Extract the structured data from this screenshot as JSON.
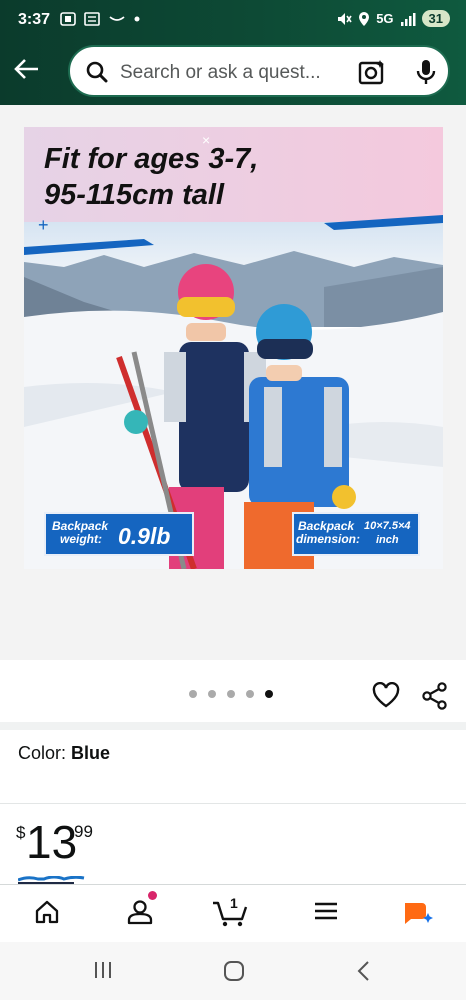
{
  "status_bar": {
    "time": "3:37",
    "network": "5G",
    "battery": "31"
  },
  "search": {
    "placeholder": "Search or ask a quest..."
  },
  "product_image": {
    "headline_line1": "Fit for ages 3-7,",
    "headline_line2": "95-115cm tall",
    "badge_weight_label_1": "Backpack",
    "badge_weight_label_2": "weight:",
    "badge_weight_value": "0.9lb",
    "badge_dim_label_1": "Backpack",
    "badge_dim_label_2": "dimension:",
    "badge_dim_value": "10×7.5×4",
    "badge_dim_unit": "inch"
  },
  "carousel": {
    "total_images": 5,
    "active_index": 4
  },
  "color": {
    "label": "Color:",
    "value": "Blue"
  },
  "price": {
    "currency": "$",
    "whole": "13",
    "fraction": "99"
  },
  "bottom_nav": {
    "items": [
      "home-icon",
      "account-icon",
      "cart-icon",
      "menu-icon",
      "rufus-icon"
    ],
    "cart_count": "1"
  },
  "colors": {
    "header_green": "#0d4a35",
    "badge_blue": "#1565c0",
    "accent_orange": "#ff6a13",
    "notification_pink": "#d8256a"
  }
}
